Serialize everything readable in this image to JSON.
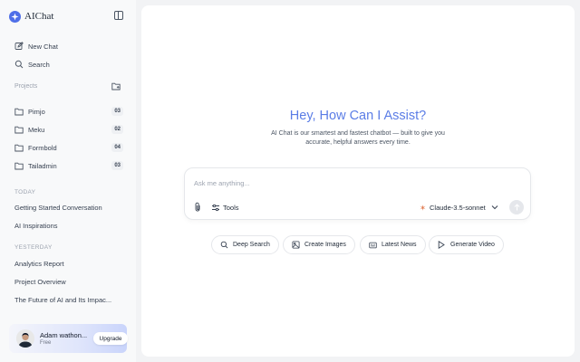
{
  "app": {
    "name": "AIChat",
    "accent": "#4f6fe8"
  },
  "sidebar": {
    "new_chat": "New Chat",
    "search": "Search",
    "projects_label": "Projects",
    "projects": [
      {
        "name": "Pimjo",
        "count": "03"
      },
      {
        "name": "Meku",
        "count": "02"
      },
      {
        "name": "Formbold",
        "count": "04"
      },
      {
        "name": "Tailadmin",
        "count": "03"
      }
    ],
    "today_label": "TODAY",
    "today": [
      {
        "title": "Getting Started Conversation"
      },
      {
        "title": "AI Inspirations"
      }
    ],
    "yesterday_label": "YESTERDAY",
    "yesterday": [
      {
        "title": "Analytics Report"
      },
      {
        "title": "Project Overview"
      },
      {
        "title": "The Future of AI and Its Impac..."
      }
    ],
    "user": {
      "name": "Adam wathon...",
      "plan": "Free",
      "upgrade_label": "Upgrade"
    }
  },
  "main": {
    "title": "Hey, How Can I Assist?",
    "subtitle": "AI Chat is our smartest and fastest chatbot — built to give you accurate, helpful answers every time.",
    "composer": {
      "placeholder": "Ask me anything...",
      "tools_label": "Tools",
      "model": "Claude-3.5-sonnet"
    },
    "suggestions": [
      {
        "label": "Deep Search",
        "icon": "search-icon"
      },
      {
        "label": "Create Images",
        "icon": "image-icon"
      },
      {
        "label": "Latest News",
        "icon": "news-icon"
      },
      {
        "label": "Generate Video",
        "icon": "play-icon"
      }
    ]
  }
}
